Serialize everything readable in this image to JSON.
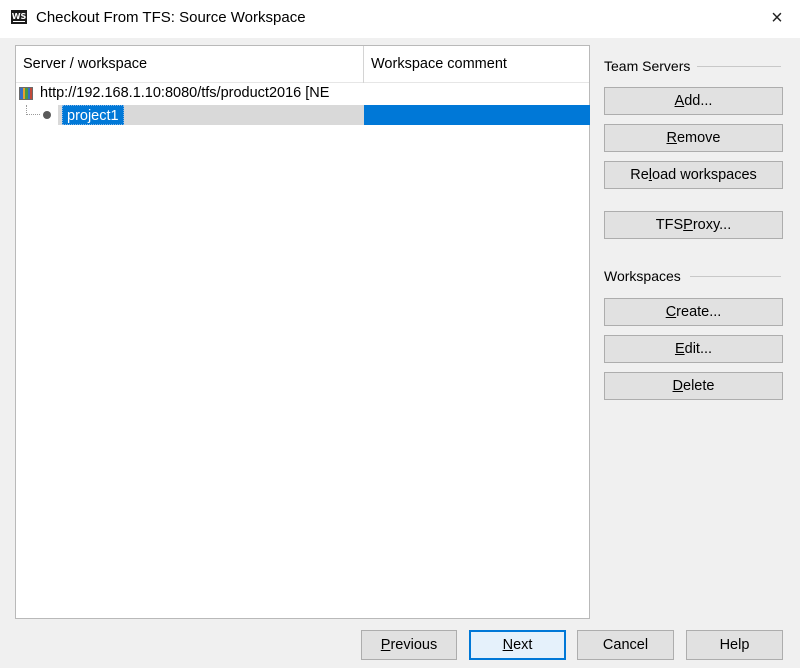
{
  "window": {
    "app_icon_text": "WS",
    "title": "Checkout From TFS: Source Workspace",
    "close_glyph": "×"
  },
  "tree": {
    "columns": [
      "Server / workspace",
      "Workspace comment"
    ],
    "server": {
      "label": "http://192.168.1.10:8080/tfs/product2016 [NE",
      "icon": "tfs-server-icon"
    },
    "workspace": {
      "label": "project1",
      "comment": "",
      "selected": true,
      "icon": "workspace-node-icon"
    }
  },
  "team_servers": {
    "title": "Team Servers",
    "buttons": {
      "add": {
        "pre": "",
        "key": "A",
        "post": "dd..."
      },
      "remove": {
        "pre": "",
        "key": "R",
        "post": "emove"
      },
      "reload": {
        "pre": "Re",
        "key": "l",
        "post": "oad workspaces"
      },
      "proxy": {
        "pre": "TFS ",
        "key": "P",
        "post": "roxy..."
      }
    }
  },
  "workspaces": {
    "title": "Workspaces",
    "buttons": {
      "create": {
        "pre": "",
        "key": "C",
        "post": "reate..."
      },
      "edit": {
        "pre": "",
        "key": "E",
        "post": "dit..."
      },
      "delete": {
        "pre": "",
        "key": "D",
        "post": "elete"
      }
    }
  },
  "footer": {
    "previous": {
      "pre": "",
      "key": "P",
      "post": "revious"
    },
    "next": {
      "pre": "",
      "key": "N",
      "post": "ext"
    },
    "cancel": "Cancel",
    "help": "Help"
  },
  "colors": {
    "selection": "#0078d7",
    "button_face": "#e1e1e1",
    "button_border": "#adadad",
    "default_button_border": "#0078d7"
  }
}
